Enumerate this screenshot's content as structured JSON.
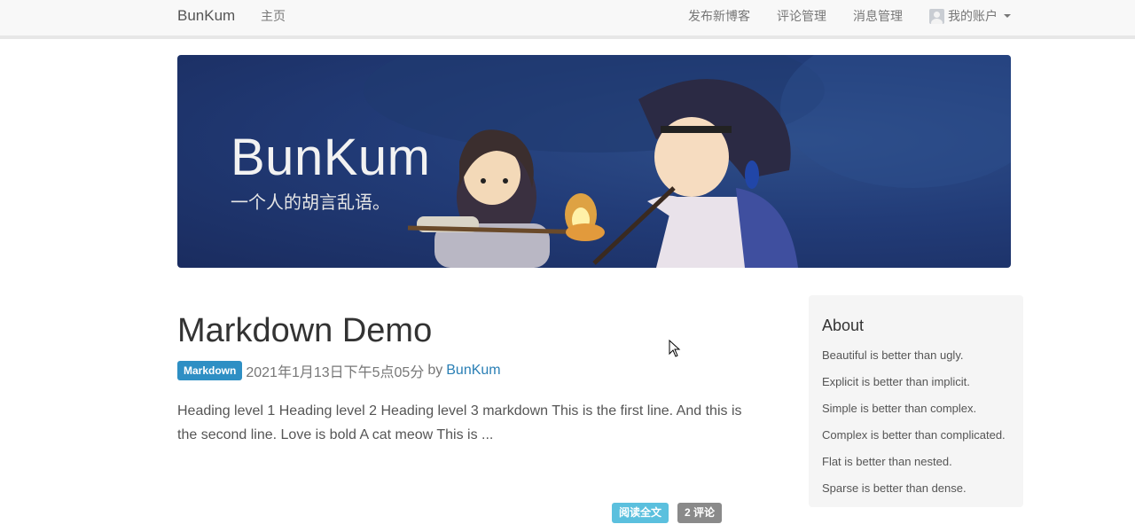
{
  "navbar": {
    "brand": "BunKum",
    "home": "主页",
    "links": [
      "发布新博客",
      "评论管理",
      "消息管理"
    ],
    "account": "我的账户"
  },
  "banner": {
    "title": "BunKum",
    "subtitle": "一个人的胡言乱语。"
  },
  "post": {
    "title": "Markdown Demo",
    "tag": "Markdown",
    "date": "2021年1月13日下午5点05分",
    "by": "by",
    "author": "BunKum",
    "excerpt": "Heading level 1 Heading level 2 Heading level 3 markdown This is the first line. And this is the second line. Love is bold A cat meow This is ...",
    "read_more": "阅读全文",
    "comments": "2 评论"
  },
  "sidebar": {
    "heading": "About",
    "items": [
      "Beautiful is better than ugly.",
      "Explicit is better than implicit.",
      "Simple is better than complex.",
      "Complex is better than complicated.",
      "Flat is better than nested.",
      "Sparse is better than dense."
    ]
  },
  "colors": {
    "tag": "#2e8fc4",
    "link": "#2a7fb5",
    "read_button": "#5bc0de",
    "comments_button": "#8a8a8a",
    "banner": "#223c78"
  }
}
